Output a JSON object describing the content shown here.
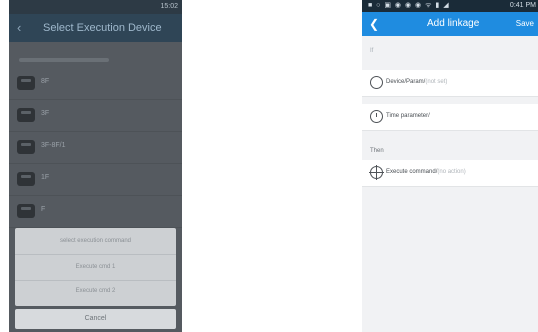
{
  "left": {
    "status_time": "15:02",
    "header_title": "Select Execution Device",
    "devices": [
      {
        "label": "8F"
      },
      {
        "label": "3F"
      },
      {
        "label": "3F-8F/1"
      },
      {
        "label": "1F"
      },
      {
        "label": "F"
      }
    ],
    "dialog": {
      "line1": "select execution command",
      "line2": "Execute cmd 1",
      "line3": "Execute cmd 2"
    },
    "cancel_label": "Cancel"
  },
  "right": {
    "status_icons": "■ ○ ▣ ◉ ◉ ◉  ᯤ ▮ ◢",
    "status_time": "0:41 PM",
    "header_title": "Add linkage",
    "save_label": "Save",
    "section_if": "If",
    "device_label": "Device/Param/",
    "device_hint": "(not set)",
    "time_label": "Time parameter/",
    "section_then": "Then",
    "execute_label": "Execute command/",
    "execute_hint": "(no action)"
  }
}
